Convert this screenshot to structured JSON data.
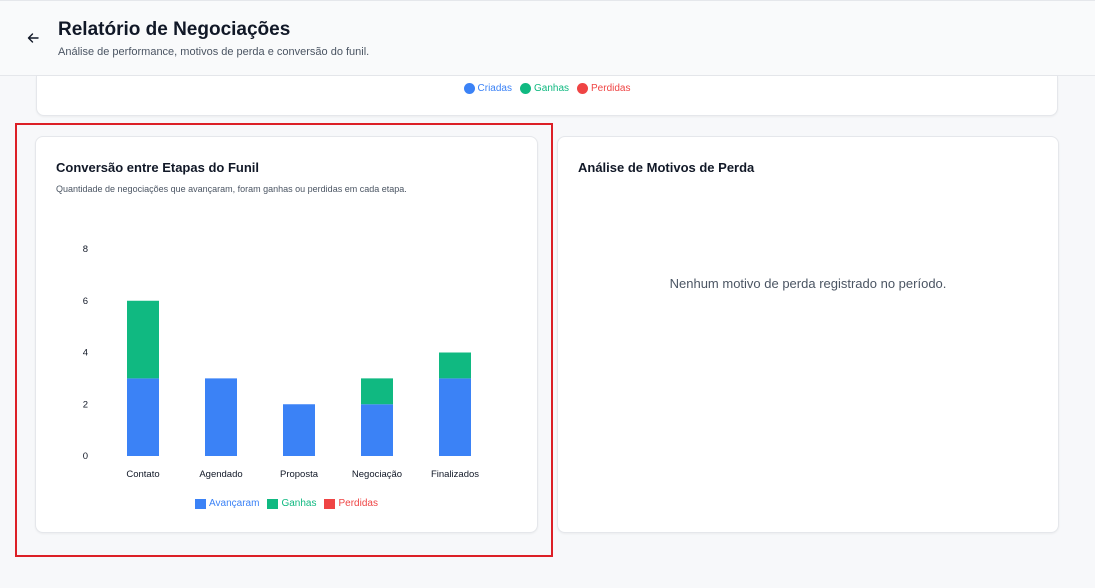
{
  "header": {
    "title": "Relatório de Negociações",
    "subtitle": "Análise de performance, motivos de perda e conversão do funil."
  },
  "top_legend": [
    {
      "label": "Criadas",
      "color": "#3b82f6"
    },
    {
      "label": "Ganhas",
      "color": "#10b981"
    },
    {
      "label": "Perdidas",
      "color": "#ef4444"
    }
  ],
  "funnel_card": {
    "title": "Conversão entre Etapas do Funil",
    "description": "Quantidade de negociações que avançaram, foram ganhas ou perdidas em cada etapa."
  },
  "loss_card": {
    "title": "Análise de Motivos de Perda",
    "empty_message": "Nenhum motivo de perda registrado no período."
  },
  "chart_data": {
    "type": "bar",
    "stacked": true,
    "categories": [
      "Contato",
      "Agendado",
      "Proposta",
      "Negociação",
      "Finalizados"
    ],
    "series": [
      {
        "name": "Avançaram",
        "color": "#3b82f6",
        "values": [
          3,
          3,
          2,
          2,
          3
        ]
      },
      {
        "name": "Ganhas",
        "color": "#10b981",
        "values": [
          3,
          0,
          0,
          1,
          1
        ]
      },
      {
        "name": "Perdidas",
        "color": "#ef4444",
        "values": [
          0,
          0,
          0,
          0,
          0
        ]
      }
    ],
    "yticks": [
      0,
      2,
      4,
      6,
      8
    ],
    "ylim": [
      0,
      8
    ],
    "grid": false,
    "legend": "bottom"
  }
}
